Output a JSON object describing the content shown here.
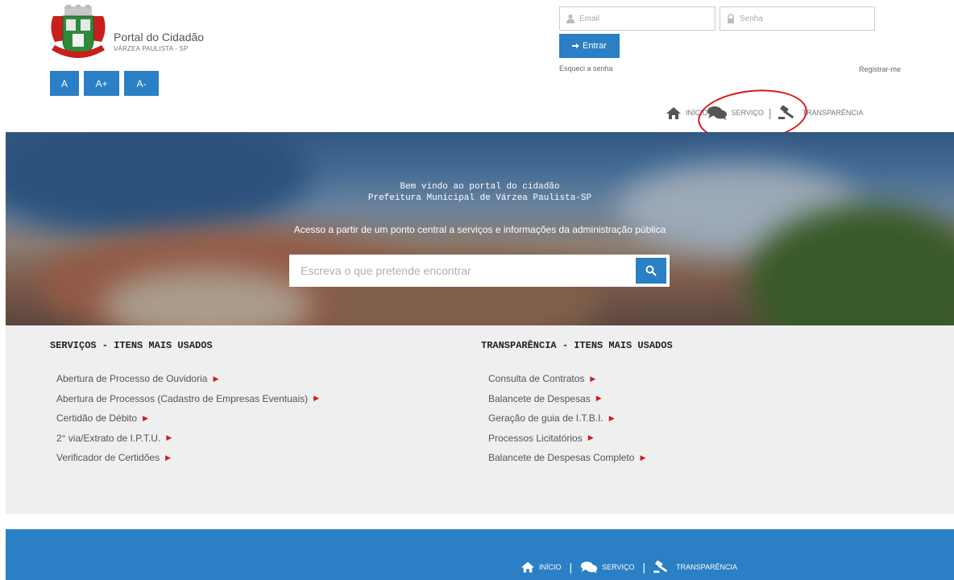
{
  "header": {
    "portal_title": "Portal do Cidadão",
    "city": "VÁRZEA PAULISTA - SP",
    "font_buttons": [
      "A",
      "A+",
      "A-"
    ]
  },
  "login": {
    "email_placeholder": "Email",
    "senha_placeholder": "Senha",
    "entrar_label": "Entrar",
    "esqueci_label": "Esqueci a senha",
    "registrar_label": "Registrar-me"
  },
  "nav": {
    "inicio": "INÍCIO",
    "servico": "SERVIÇO",
    "separator": "|",
    "transparencia": "TRANSPARÊNCIA"
  },
  "hero": {
    "welcome_line1": "Bem vindo ao portal do cidadão",
    "welcome_line2": "Prefeitura Municipal de Várzea Paulista-SP",
    "tagline": "Acesso a partir de um ponto central a serviços e informações da administração pública",
    "search_placeholder": "Escreva o que pretende encontrar"
  },
  "services": {
    "heading": "SERVIÇOS - ITENS MAIS USADOS",
    "items": [
      "Abertura de Processo de Ouvidoria",
      "Abertura de Processos (Cadastro de Empresas Eventuais)",
      "Certidão de Débito",
      "2° via/Extrato de I.P.T.U.",
      "Verificador de Certidões"
    ]
  },
  "transparency": {
    "heading": "TRANSPARÊNCIA - ITENS MAIS USADOS",
    "items": [
      "Consulta de Contratos",
      "Balancete de Despesas",
      "Geração de guia de I.T.B.I.",
      "Processos Licitatórios",
      "Balancete de Despesas Completo"
    ]
  },
  "colors": {
    "primary": "#2a7fc5",
    "caret": "#cc1d1d",
    "highlight_circle": "#d7191c",
    "list_bg": "#efefef"
  },
  "icons": [
    "person-icon",
    "lock-icon",
    "sign-in-icon",
    "home-icon",
    "chat-icon",
    "gavel-icon",
    "search-icon",
    "caret-right-icon"
  ]
}
